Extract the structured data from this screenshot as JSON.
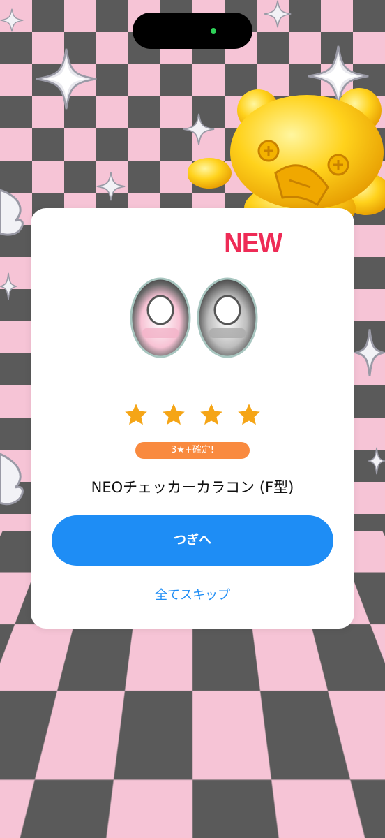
{
  "card": {
    "badge": "NEW",
    "rarity_stars": 4,
    "guarantee_label": "3★+確定!",
    "item_name": "NEOチェッカーカラコン (F型)",
    "next_button_label": "つぎへ",
    "skip_all_label": "全てスキップ"
  },
  "colors": {
    "badge": "#ee2b56",
    "star": "#f5a516",
    "guarantee_pill": "#f98a3f",
    "primary_button": "#1e8df5",
    "checker_dark": "#5a5a5a",
    "checker_light": "#f6c4d6"
  },
  "icons": {
    "item_image": "eye-contact-lenses-icon",
    "rarity": "star-icon",
    "decoration": [
      "sparkle-icon",
      "gold-bear-figure"
    ]
  }
}
